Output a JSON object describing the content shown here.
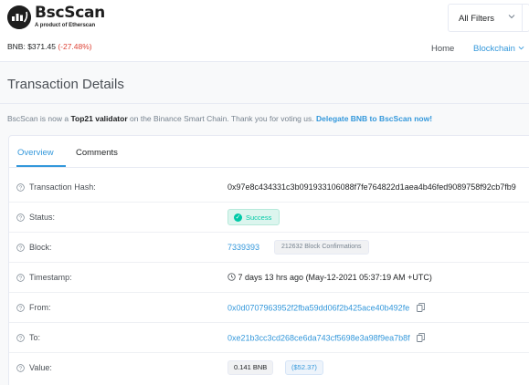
{
  "header": {
    "logo_name": "BscScan",
    "logo_sub": "A product of Etherscan",
    "price_label": "BNB: $371.45",
    "price_change": "(-27.48%)",
    "filter_label": "All Filters",
    "nav_home": "Home",
    "nav_blockchain": "Blockchain"
  },
  "page": {
    "title": "Transaction Details",
    "notice_prefix": "BscScan is now a ",
    "notice_bold": "Top21 validator",
    "notice_mid": " on the Binance Smart Chain. Thank you for voting us. ",
    "notice_link": "Delegate BNB to BscScan now!"
  },
  "tabs": [
    {
      "label": "Overview",
      "active": true
    },
    {
      "label": "Comments",
      "active": false
    }
  ],
  "details": {
    "hash_label": "Transaction Hash:",
    "hash_value": "0x97e8c434331c3b091933106088f7fe764822d1aea4b46fed9089758f92cb7fb9",
    "status_label": "Status:",
    "status_value": "Success",
    "block_label": "Block:",
    "block_number": "7339393",
    "block_confirmations": "212632 Block Confirmations",
    "timestamp_label": "Timestamp:",
    "timestamp_value": "7 days 13 hrs ago (May-12-2021 05:37:19 AM +UTC)",
    "from_label": "From:",
    "from_value": "0x0d0707963952f2fba59dd06f2b425ace40b492fe",
    "to_label": "To:",
    "to_value": "0xe21b3cc3cd268ce6da743cf5698e3a98f9ea7b8f",
    "value_label": "Value:",
    "value_bnb": "0.141 BNB",
    "value_usd": "($52.37)"
  },
  "colors": {
    "accent": "#3498db",
    "success": "#00c9a7",
    "negative": "#de4437"
  }
}
